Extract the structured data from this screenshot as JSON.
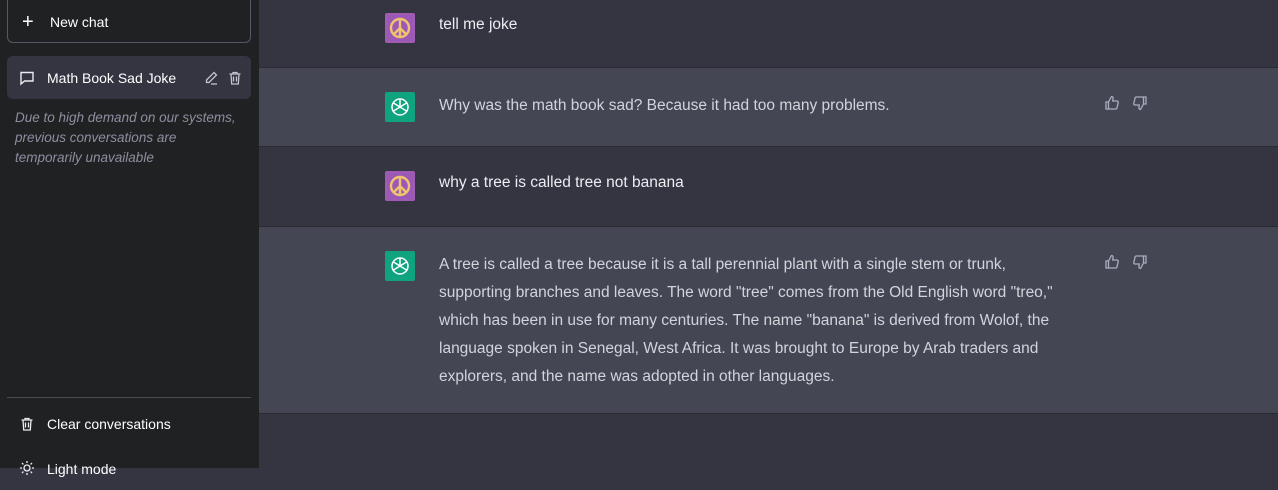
{
  "sidebar": {
    "new_chat_label": "New chat",
    "conversations": [
      {
        "title": "Math Book Sad Joke"
      }
    ],
    "notice": "Due to high demand on our systems, previous conversations are temporarily unavailable",
    "clear_label": "Clear conversations",
    "mode_label": "Light mode"
  },
  "messages": [
    {
      "role": "user",
      "text": "tell me joke"
    },
    {
      "role": "assistant",
      "text": "Why was the math book sad? Because it had too many problems."
    },
    {
      "role": "user",
      "text": "why a tree is called tree not banana"
    },
    {
      "role": "assistant",
      "text": "A tree is called a tree because it is a tall perennial plant with a single stem or trunk, supporting branches and leaves. The word \"tree\" comes from the Old English word \"treo,\" which has been in use for many centuries. The name \"banana\" is derived from Wolof, the language spoken in Senegal, West Africa. It was brought to Europe by Arab traders and explorers, and the name was adopted in other languages."
    }
  ],
  "colors": {
    "sidebar_bg": "#202123",
    "user_bg": "#343541",
    "assistant_bg": "#444654",
    "bot_avatar": "#10a37f",
    "user_avatar": "#a05cb4"
  },
  "icons": [
    "plus-icon",
    "chat-bubble-icon",
    "edit-icon",
    "trash-icon",
    "peace-sign-icon",
    "openai-logo-icon",
    "thumbs-up-icon",
    "thumbs-down-icon",
    "sun-icon"
  ]
}
